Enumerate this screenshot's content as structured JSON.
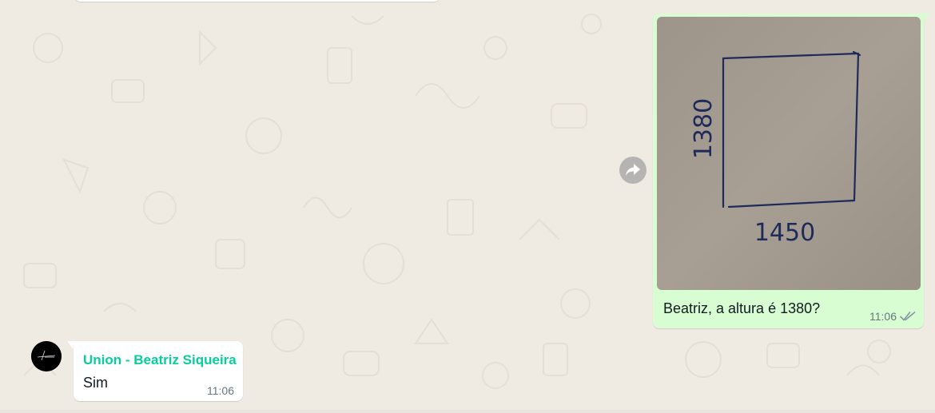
{
  "chat": {
    "background_color": "#efeae2"
  },
  "outgoing_message": {
    "photo": {
      "sketch_height_label": "1380",
      "sketch_width_label": "1450"
    },
    "caption": "Beatriz, a altura é 1380?",
    "time": "11:06",
    "status_icon": "double-check-icon",
    "bubble_color": "#d9fdd3"
  },
  "forward_action": {
    "icon": "forward-arrow-icon"
  },
  "incoming_message": {
    "sender": "Union - Beatriz Siqueira",
    "sender_color": "#06cf9c",
    "text": "Sim",
    "time": "11:06",
    "bubble_color": "#ffffff"
  }
}
